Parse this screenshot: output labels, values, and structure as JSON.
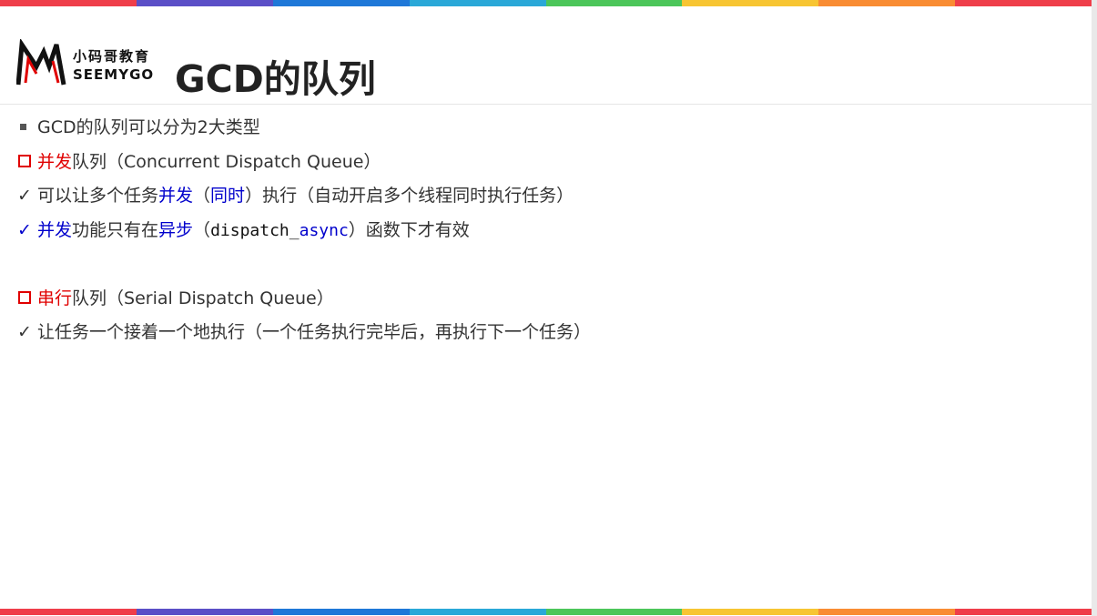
{
  "colors": {
    "stripe": [
      "#ef3e4a",
      "#5b4fc7",
      "#1f78d8",
      "#2aa8d8",
      "#4cc65a",
      "#f7c532",
      "#f98c33",
      "#ef3e4a"
    ],
    "accent_red": "#e00000",
    "accent_blue": "#0000cc"
  },
  "logo": {
    "cn": "小码哥教育",
    "en": "SEEMYGO"
  },
  "title": "GCD的队列",
  "lines": {
    "intro": "GCD的队列可以分为2大类型",
    "concurrent": {
      "head_red": "并发",
      "head_rest": "队列（Concurrent Dispatch Queue）",
      "l1": {
        "a": "可以让多个任务",
        "b_blue": "并发",
        "c": "（",
        "d_blue": "同时",
        "e": "）执行（自动开启多个线程同时执行任务）"
      },
      "l2": {
        "a_blue": "并发",
        "b": "功能只有在",
        "c_blue": "异步",
        "d": "（",
        "code1": "dispatch_",
        "code2_blue": "async",
        "e": "）函数下才有效"
      }
    },
    "serial": {
      "head_red": "串行",
      "head_rest": "队列（Serial Dispatch Queue）",
      "l1": "让任务一个接着一个地执行（一个任务执行完毕后，再执行下一个任务）"
    }
  },
  "icons": {
    "check": "✓",
    "logo": "mj-logo-icon"
  }
}
